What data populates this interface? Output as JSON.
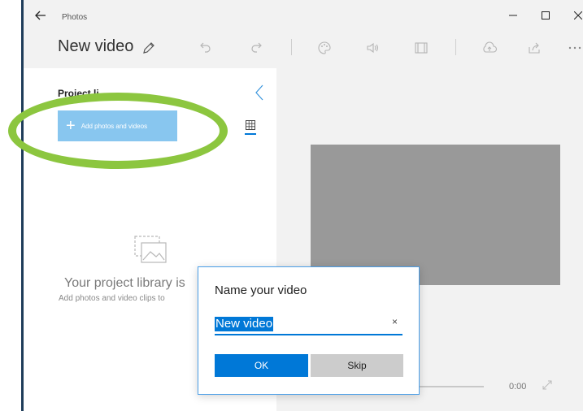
{
  "titlebar": {
    "app_title": "Photos",
    "back_icon": "back-arrow-icon",
    "controls": [
      "minimize-icon",
      "maximize-icon",
      "close-icon"
    ]
  },
  "toolbar": {
    "doc_title": "New video",
    "tools": [
      "pencil-icon",
      "undo-icon",
      "redo-icon",
      "palette-icon",
      "volume-icon",
      "aspect-ratio-icon",
      "cloud-upload-icon",
      "share-icon",
      "more-icon"
    ]
  },
  "panel": {
    "title": "Project li",
    "add_button_label": "Add photos and videos",
    "empty_title": "Your project library is",
    "empty_subtitle": "Add photos and video clips to"
  },
  "player": {
    "time": "0:00"
  },
  "dialog": {
    "title": "Name your video",
    "name_value": "New video",
    "clear_glyph": "×",
    "ok_label": "OK",
    "skip_label": "Skip"
  },
  "colors": {
    "accent": "#0078d7",
    "add_button": "#88c6ef",
    "highlight_ring": "#8cc63f",
    "preview": "#999999",
    "window_bg": "#f2f2f2"
  }
}
